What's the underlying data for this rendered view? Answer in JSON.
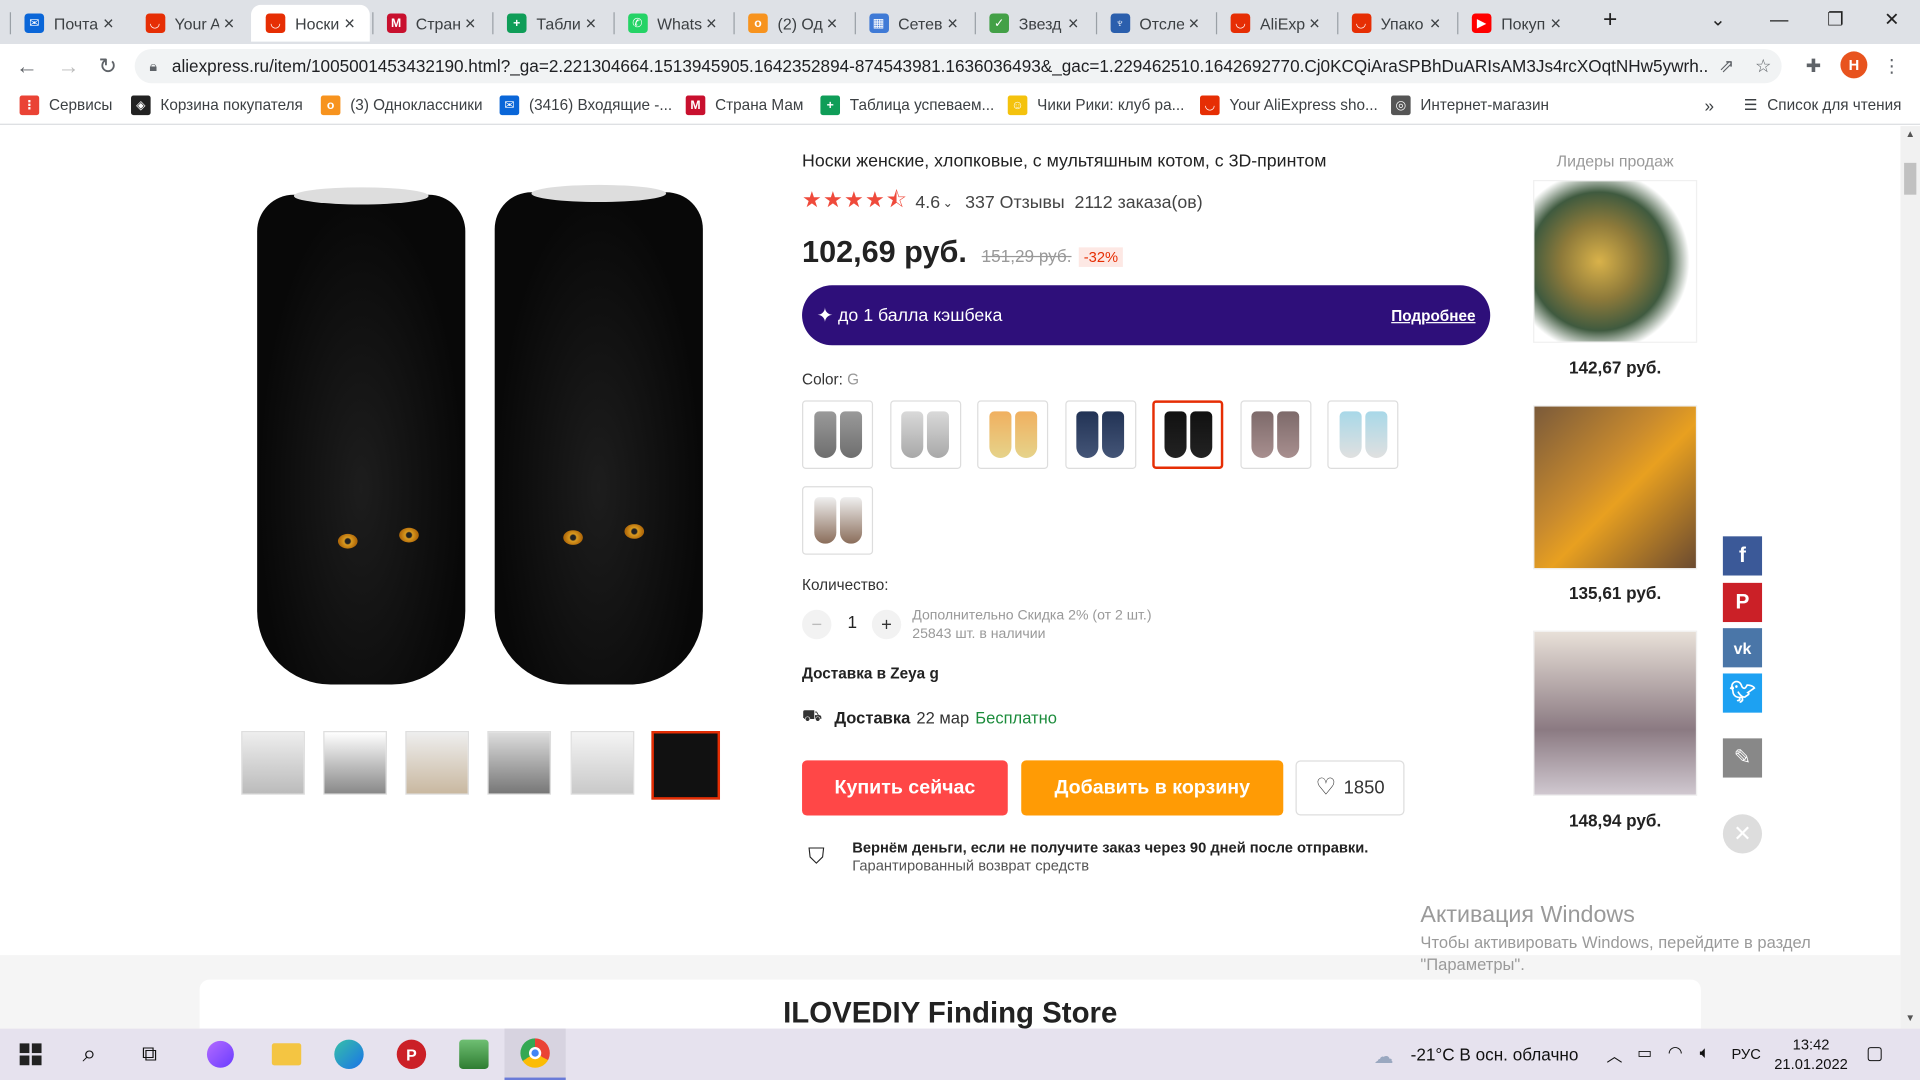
{
  "tabs": [
    {
      "label": "Почта",
      "color": "#0a66d8",
      "glyph": "✉"
    },
    {
      "label": "Your A",
      "color": "#e62e04",
      "glyph": "◡"
    },
    {
      "label": "Носки",
      "color": "#e62e04",
      "glyph": "◡"
    },
    {
      "label": "Стран",
      "color": "#c8102e",
      "glyph": "M"
    },
    {
      "label": "Табли",
      "color": "#0f9d58",
      "glyph": "+"
    },
    {
      "label": "Whats",
      "color": "#25d366",
      "glyph": "✆"
    },
    {
      "label": "(2) Од",
      "color": "#f7931e",
      "glyph": "о"
    },
    {
      "label": "Сетев",
      "color": "#3f7ad6",
      "glyph": "▦"
    },
    {
      "label": "Звезд",
      "color": "#43a047",
      "glyph": "✓"
    },
    {
      "label": "Отсле",
      "color": "#2b5fad",
      "glyph": "♆"
    },
    {
      "label": "AliExp",
      "color": "#e62e04",
      "glyph": "◡"
    },
    {
      "label": "Упако",
      "color": "#e62e04",
      "glyph": "◡"
    },
    {
      "label": "Покуп",
      "color": "#ff0000",
      "glyph": "▶"
    }
  ],
  "url": "aliexpress.ru/item/1005001453432190.html?_ga=2.221304664.1513945905.1642352894-874543981.1636036493&_gac=1.229462510.1642692770.Cj0KCQiAraSPBhDuARIsAM3Js4rcXOqtNHw5ywrh...",
  "profile_initial": "Н",
  "bookmarks": [
    {
      "label": "Сервисы",
      "color": "#ea4335",
      "glyph": "⋮"
    },
    {
      "label": "Корзина покупателя",
      "color": "#222",
      "glyph": "◈"
    },
    {
      "label": "(3) Одноклассники",
      "color": "#f7931e",
      "glyph": "о"
    },
    {
      "label": "(3416) Входящие -...",
      "color": "#0a66d8",
      "glyph": "✉"
    },
    {
      "label": "Страна Мам",
      "color": "#c8102e",
      "glyph": "M"
    },
    {
      "label": "Таблица успеваем...",
      "color": "#0f9d58",
      "glyph": "+"
    },
    {
      "label": "Чики Рики: клуб ра...",
      "color": "#f4c20d",
      "glyph": "☺"
    },
    {
      "label": "Your AliExpress sho...",
      "color": "#e62e04",
      "glyph": "◡"
    },
    {
      "label": "Интернет-магазин",
      "color": "#555",
      "glyph": "◎"
    }
  ],
  "bookmarks_more": "»",
  "reading_list": "Список для чтения",
  "product": {
    "title": "Носки женские, хлопковые, с мультяшным котом, с 3D-принтом",
    "rating": 4.6,
    "rating_label": "4.6",
    "reviews": "337 Отзывы",
    "orders": "2112 заказа(ов)",
    "price": "102,69 руб.",
    "old_price": "151,29 руб.",
    "discount": "-32%",
    "cashback": "до 1 балла кэшбека",
    "cashback_more": "Подробнее",
    "color_label": "Color:",
    "color_value": "G",
    "variants": [
      {
        "a": "#9a9a9a",
        "b": "#6e6e6e"
      },
      {
        "a": "#d9d9d9",
        "b": "#a8a8a8"
      },
      {
        "a": "#f0b060",
        "b": "#e6d38a"
      },
      {
        "a": "#223355",
        "b": "#445577"
      },
      {
        "a": "#111111",
        "b": "#222222"
      },
      {
        "a": "#7d6a6a",
        "b": "#a88f8f"
      },
      {
        "a": "#a8d8e8",
        "b": "#e0e0e0"
      },
      {
        "a": "#efefef",
        "b": "#8a6d5a"
      }
    ],
    "quantity_label": "Количество:",
    "quantity": "1",
    "extra_discount": "Дополнительно Скидка 2% (от 2 шт.)",
    "stock": "25843 шт. в наличии",
    "delivery_to": "Доставка в Zeya g",
    "delivery_label": "Доставка",
    "delivery_date": "22 мар",
    "delivery_price": "Бесплатно",
    "buy_now": "Купить сейчас",
    "add_cart": "Добавить в корзину",
    "wishlist_count": "1850",
    "guarantee_title": "Вернём деньги, если не получите заказ через 90 дней после отправки.",
    "guarantee_sub": "Гарантированный возврат средств",
    "store_name": "ILOVEDIY Finding Store"
  },
  "bestsellers": {
    "title": "Лидеры продаж",
    "items": [
      {
        "price": "142,67 руб."
      },
      {
        "price": "135,61 руб."
      },
      {
        "price": "148,94 руб."
      }
    ]
  },
  "windows_activation": {
    "title": "Активация Windows",
    "line1": "Чтобы активировать Windows, перейдите в раздел",
    "line2": "\"Параметры\"."
  },
  "taskbar": {
    "weather": "-21°C  В осн. облачно",
    "lang": "РУС",
    "time": "13:42",
    "date": "21.01.2022"
  },
  "colors": {
    "accent": "#e62e04",
    "buy_now_bg": "#ff4747",
    "cart_bg": "#ff9b05",
    "cashback_bg": "#2e0f7a",
    "star": "#ef4a3b",
    "delivery_free": "#1c8c3c"
  }
}
